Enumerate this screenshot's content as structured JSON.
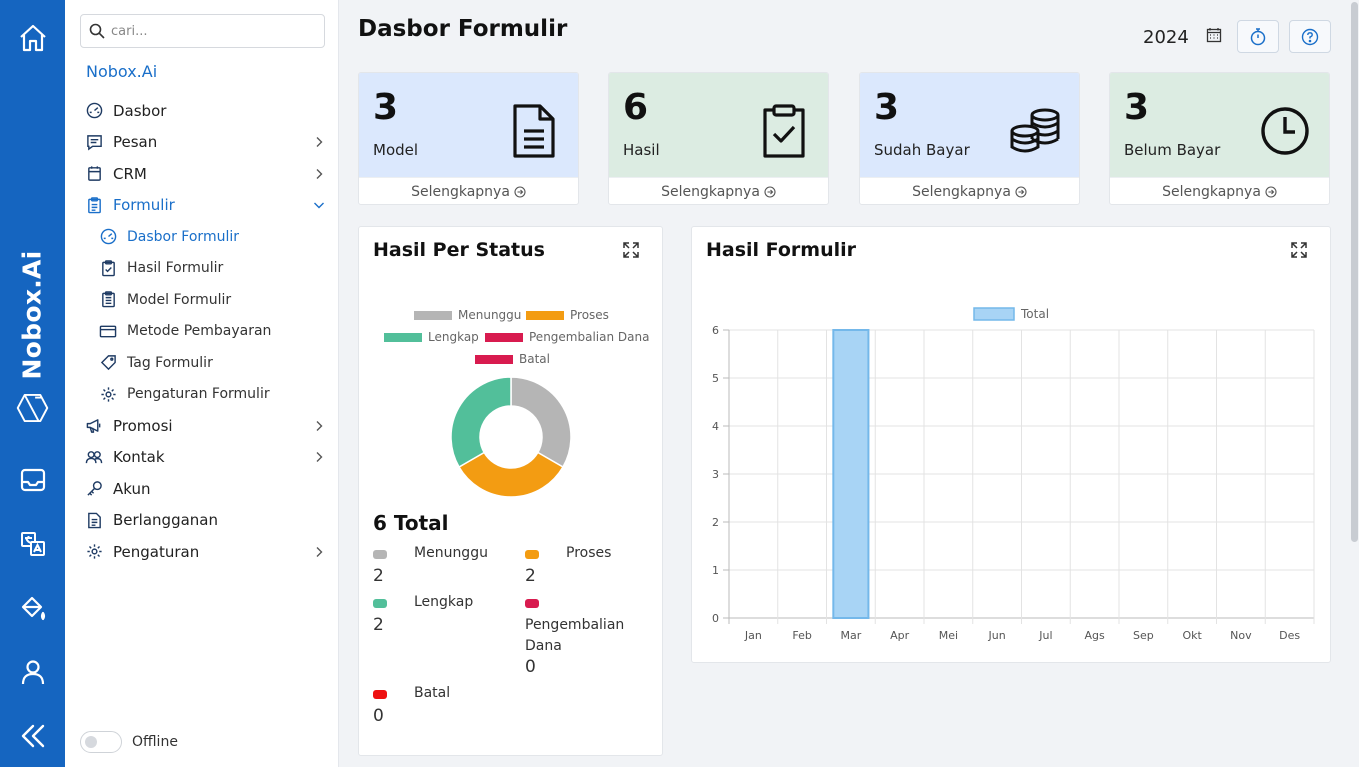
{
  "rail": {
    "brand": "Nobox.Ai",
    "icons": [
      "home-icon",
      "nobox-logo-icon",
      "inbox-icon",
      "translate-icon",
      "paint-bucket-icon",
      "user-icon",
      "collapse-icon"
    ]
  },
  "sidebar": {
    "search_placeholder": "cari...",
    "brand": "Nobox.Ai",
    "items": [
      {
        "label": "Dasbor",
        "icon": "gauge-icon"
      },
      {
        "label": "Pesan",
        "icon": "message-icon"
      },
      {
        "label": "CRM",
        "icon": "crm-icon"
      },
      {
        "label": "Formulir",
        "icon": "clipboard-icon"
      },
      {
        "label": "Dasbor Formulir",
        "icon": "gauge-icon"
      },
      {
        "label": "Hasil Formulir",
        "icon": "clipboard-check-icon"
      },
      {
        "label": "Model Formulir",
        "icon": "clipboard-list-icon"
      },
      {
        "label": "Metode Pembayaran",
        "icon": "credit-card-icon"
      },
      {
        "label": "Tag Formulir",
        "icon": "tag-icon"
      },
      {
        "label": "Pengaturan Formulir",
        "icon": "gear-icon"
      },
      {
        "label": "Promosi",
        "icon": "megaphone-icon"
      },
      {
        "label": "Kontak",
        "icon": "contacts-icon"
      },
      {
        "label": "Akun",
        "icon": "key-icon"
      },
      {
        "label": "Berlangganan",
        "icon": "document-icon"
      },
      {
        "label": "Pengaturan",
        "icon": "gear-icon"
      }
    ],
    "offline_label": "Offline"
  },
  "header": {
    "title": "Dasbor Formulir",
    "year": "2024"
  },
  "stats": [
    {
      "value": "3",
      "label": "Model",
      "more": "Selengkapnya",
      "icon": "document-icon",
      "bg": "#dbe8fd"
    },
    {
      "value": "6",
      "label": "Hasil",
      "more": "Selengkapnya",
      "icon": "clipboard-check-icon",
      "bg": "#dcece2"
    },
    {
      "value": "3",
      "label": "Sudah Bayar",
      "more": "Selengkapnya",
      "icon": "coins-icon",
      "bg": "#dbe8fd"
    },
    {
      "value": "3",
      "label": "Belum Bayar",
      "more": "Selengkapnya",
      "icon": "clock-icon",
      "bg": "#dcece2"
    }
  ],
  "status_card": {
    "title": "Hasil Per Status",
    "total": "6 Total",
    "legend": [
      "Menunggu",
      "Proses",
      "Lengkap",
      "Pengembalian Dana",
      "Batal"
    ],
    "items": [
      {
        "name": "Menunggu",
        "value": "2"
      },
      {
        "name": "Proses",
        "value": "2"
      },
      {
        "name": "Lengkap",
        "value": "2"
      },
      {
        "name": "Pengembalian Dana",
        "value": "0"
      },
      {
        "name": "Batal",
        "value": "0"
      }
    ]
  },
  "results_card": {
    "title": "Hasil Formulir"
  },
  "chart_data": [
    {
      "type": "pie",
      "title": "Hasil Per Status",
      "categories": [
        "Menunggu",
        "Proses",
        "Lengkap",
        "Pengembalian Dana",
        "Batal"
      ],
      "values": [
        2,
        2,
        2,
        0,
        0
      ],
      "colors": [
        "#b5b5b5",
        "#f39c12",
        "#52bf9a",
        "#d81b4f",
        "#d81b4f"
      ],
      "legend": "top"
    },
    {
      "type": "bar",
      "title": "Hasil Formulir",
      "categories": [
        "Jan",
        "Feb",
        "Mar",
        "Apr",
        "Mei",
        "Jun",
        "Jul",
        "Ags",
        "Sep",
        "Okt",
        "Nov",
        "Des"
      ],
      "series": [
        {
          "name": "Total",
          "values": [
            0,
            0,
            6,
            0,
            0,
            0,
            0,
            0,
            0,
            0,
            0,
            0
          ],
          "color": "#a8d4f5"
        }
      ],
      "ylim": [
        0,
        6
      ],
      "yticks": [
        "0",
        "1",
        "2",
        "3",
        "4",
        "5",
        "6"
      ],
      "grid": true,
      "legend": "top"
    }
  ]
}
